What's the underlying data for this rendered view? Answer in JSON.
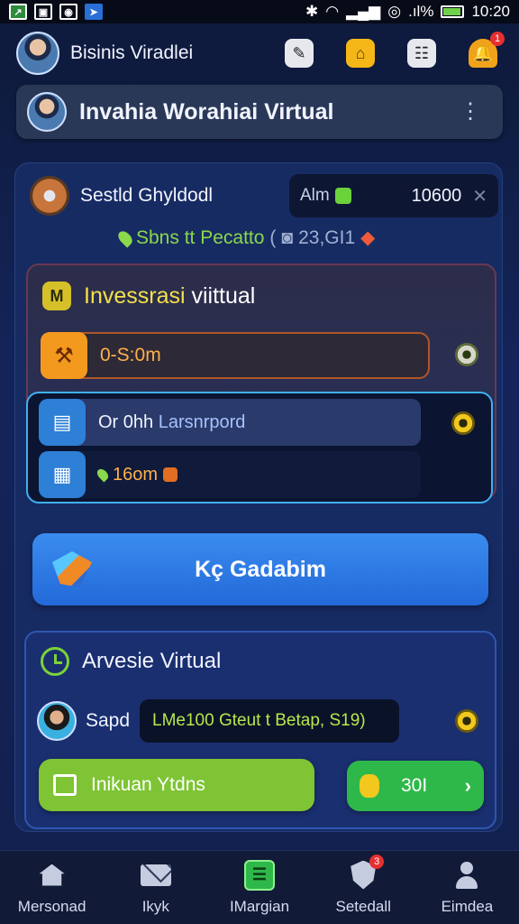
{
  "status_bar": {
    "time": "10:20",
    "battery_text": ".ıl%",
    "app_icons": [
      "chart-icon",
      "gallery-icon",
      "camera-icon",
      "send-icon"
    ]
  },
  "header": {
    "title": "Bisinis Viradlei",
    "notification_count": "1"
  },
  "title_card": {
    "title": "Invahia Worahiai Virtual"
  },
  "balance": {
    "user_name": "Sestld Ghyldodl",
    "coin_label": "Alm",
    "coin_value": "10600",
    "status_text": "Sbns tt Pecatto",
    "status_extra": "( ",
    "status_count": "23,GI1"
  },
  "invest_section": {
    "title_highlight": "Invessrasi",
    "title_rest": " viittual",
    "row1_text": "0-S:0m",
    "row2_text_white": "Or 0hh ",
    "row2_text_blue": "Larsnrpord",
    "row3_text": "16om"
  },
  "main_button": {
    "label": "Kç Gadabim"
  },
  "archive_section": {
    "title": "Arvesie Virtual",
    "user_name": "Sapd",
    "detail_text": "LMe100 Gteut t Betap, S19)",
    "invite_label": "Inikuan Ytdns",
    "score_value": "30I"
  },
  "bottom_nav": {
    "items": [
      {
        "label": "Mersonad",
        "icon": "home-icon"
      },
      {
        "label": "Ikyk",
        "icon": "mail-icon"
      },
      {
        "label": "IMargian",
        "icon": "chat-icon"
      },
      {
        "label": "Setedall",
        "icon": "shield-icon",
        "badge": "3"
      },
      {
        "label": "Eimdea",
        "icon": "person-icon"
      }
    ]
  },
  "colors": {
    "background": "#14245a",
    "accent_blue": "#2e7fd6",
    "accent_green": "#7ec434",
    "accent_orange": "#f39a1e",
    "accent_yellow": "#f4e04a"
  }
}
